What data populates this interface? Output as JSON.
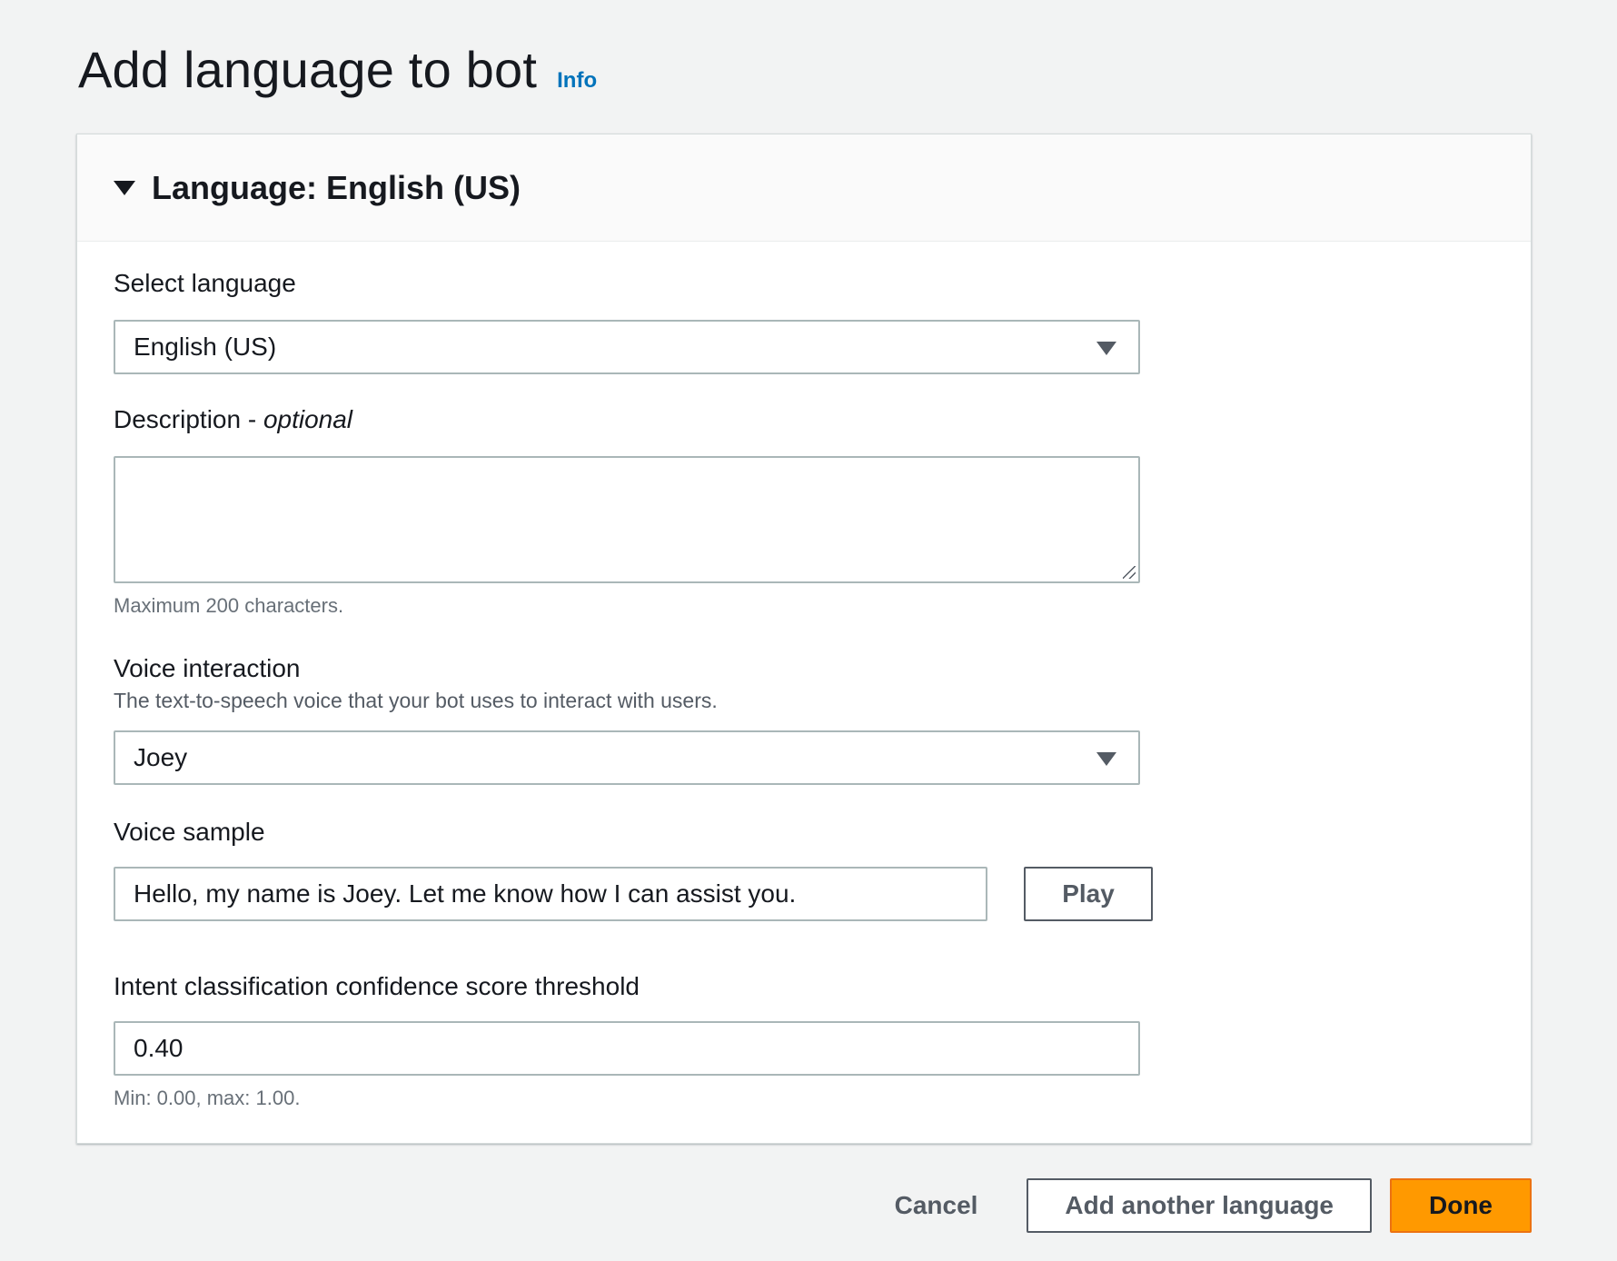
{
  "page": {
    "title": "Add language to bot",
    "info_label": "Info"
  },
  "panel": {
    "title": "Language: English (US)"
  },
  "fields": {
    "language": {
      "label": "Select language",
      "value": "English (US)"
    },
    "description": {
      "label": "Description - ",
      "label_optional": "optional",
      "value": "",
      "hint": "Maximum 200 characters."
    },
    "voice": {
      "label": "Voice interaction",
      "description": "The text-to-speech voice that your bot uses to interact with users.",
      "value": "Joey"
    },
    "voice_sample": {
      "label": "Voice sample",
      "value": "Hello, my name is Joey. Let me know how I can assist you.",
      "play_label": "Play"
    },
    "threshold": {
      "label": "Intent classification confidence score threshold",
      "value": "0.40",
      "hint": "Min: 0.00, max: 1.00."
    }
  },
  "actions": {
    "cancel_label": "Cancel",
    "add_another_label": "Add another language",
    "done_label": "Done"
  },
  "colors": {
    "accent": "#0073bb",
    "primary_button": "#ff9900",
    "background": "#f2f3f3"
  }
}
